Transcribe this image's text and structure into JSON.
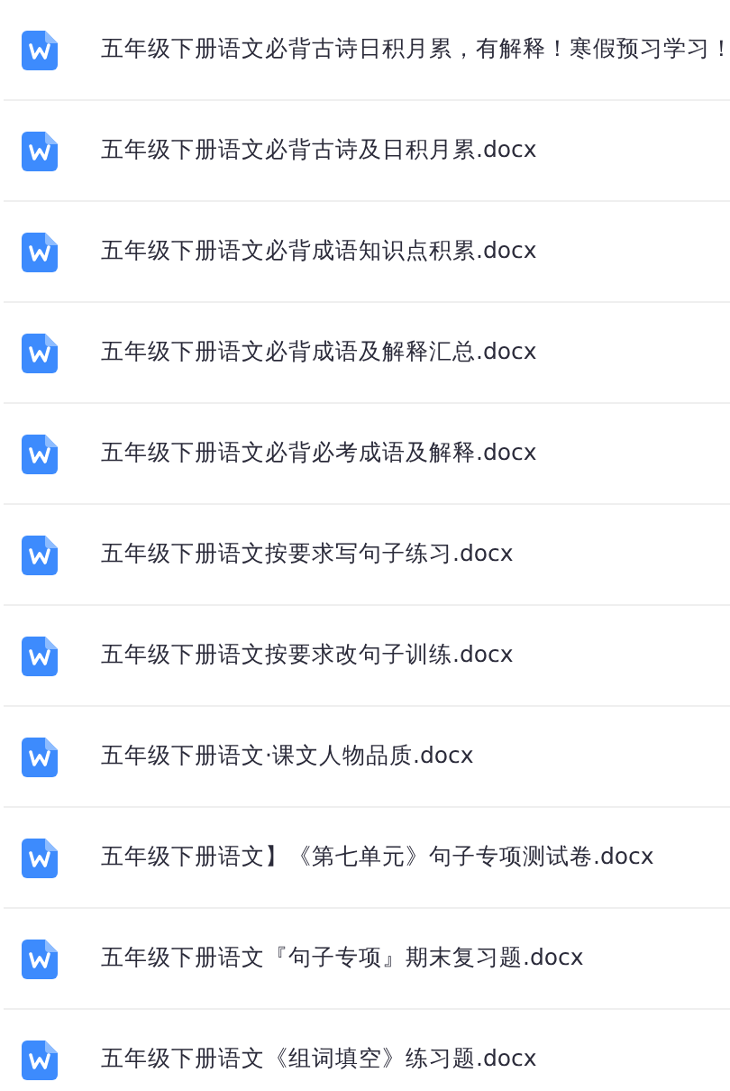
{
  "files": [
    {
      "name": "五年级下册语文必背古诗日积月累，有解释！寒假预习学习！"
    },
    {
      "name": "五年级下册语文必背古诗及日积月累.docx"
    },
    {
      "name": "五年级下册语文必背成语知识点积累.docx"
    },
    {
      "name": "五年级下册语文必背成语及解释汇总.docx"
    },
    {
      "name": "五年级下册语文必背必考成语及解释.docx"
    },
    {
      "name": "五年级下册语文按要求写句子练习.docx"
    },
    {
      "name": "五年级下册语文按要求改句子训练.docx"
    },
    {
      "name": "五年级下册语文·课文人物品质.docx"
    },
    {
      "name": "五年级下册语文】《第七单元》句子专项测试卷.docx"
    },
    {
      "name": "五年级下册语文『句子专项』期末复习题.docx"
    },
    {
      "name": "五年级下册语文《组词填空》练习题.docx"
    }
  ]
}
